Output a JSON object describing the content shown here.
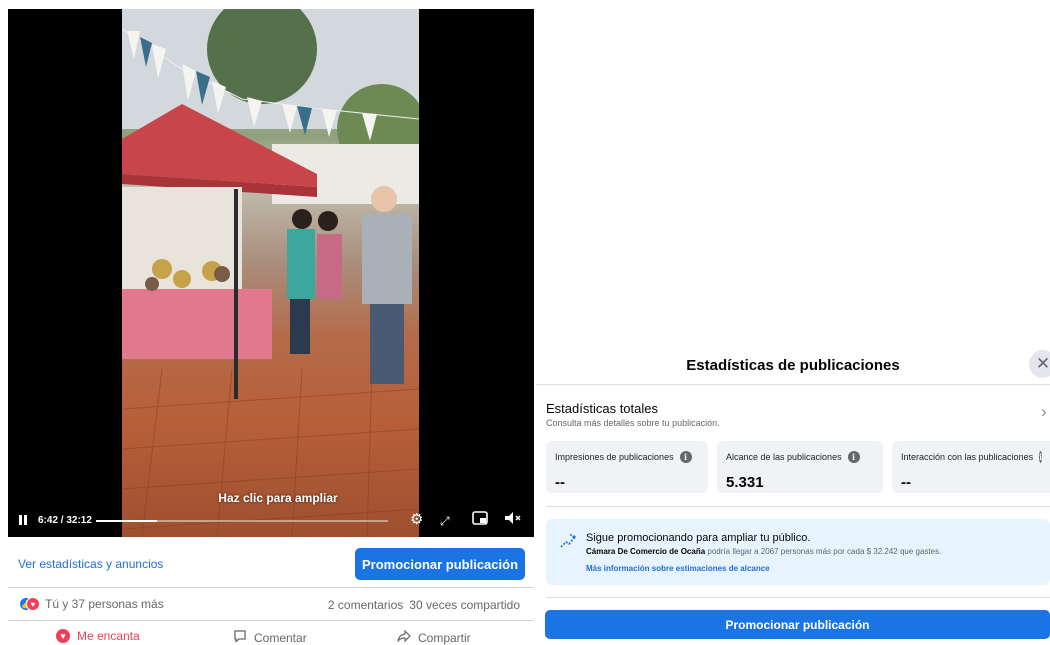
{
  "video": {
    "enlarge_hint": "Haz clic para ampliar",
    "current_time": "6:42",
    "duration": "32:12",
    "time_display": "6:42 / 32:12",
    "progress_fraction": 0.208,
    "icons": [
      "pause-icon",
      "settings-icon",
      "fullscreen-icon",
      "picture-in-picture-icon",
      "volume-muted-icon"
    ]
  },
  "post": {
    "stats_link": "Ver estadísticas y anuncios",
    "promote_button": "Promocionar publicación",
    "reactions_text": "Tú y 37 personas más",
    "comments": "2 comentarios",
    "shares": "30 veces compartido",
    "actions": {
      "love": "Me encanta",
      "comment": "Comentar",
      "share": "Compartir"
    }
  },
  "panel": {
    "title": "Estadísticas de publicaciones",
    "close_glyph": "✕",
    "totals_title": "Estadísticas totales",
    "totals_subtitle": "Consulta más detalles sobre tu publicación.",
    "metrics": [
      {
        "label": "Impresiones de publicaciones",
        "value": "--"
      },
      {
        "label": "Alcance de las publicaciones",
        "value": "5.331"
      },
      {
        "label": "Interacción con las publicaciones",
        "value": "--"
      }
    ],
    "promo": {
      "title": "Sigue promocionando para ampliar tu público.",
      "page_name": "Cámara De Comercio de Ocaña",
      "description": "podría llegar a 2067 personas más por cada $ 32.242 que gastes.",
      "link": "Más información sobre estimaciones de alcance"
    },
    "promote_button": "Promocionar publicación"
  },
  "colors": {
    "brand_blue": "#1b74e4",
    "link_blue": "#216fdb",
    "love_red": "#f33e58",
    "promo_bg": "#e7f3ff"
  }
}
